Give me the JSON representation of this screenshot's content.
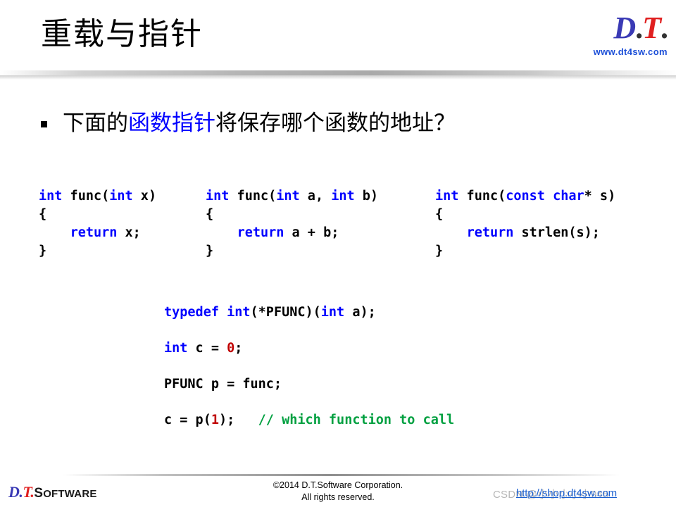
{
  "slide": {
    "title": "重载与指针",
    "bullet": {
      "prefix": "下面的",
      "highlight": "函数指针",
      "suffix": "将保存哪个函数的地址？"
    }
  },
  "logo": {
    "d": "D",
    "dot1": ".",
    "t": "T",
    "dot2": ".",
    "url": "www.dt4sw.com"
  },
  "code": {
    "col1": [
      {
        "segments": [
          {
            "t": "int",
            "c": "kw"
          },
          {
            "t": " func(",
            "c": ""
          },
          {
            "t": "int",
            "c": "kw"
          },
          {
            "t": " x)",
            "c": ""
          }
        ]
      },
      {
        "segments": [
          {
            "t": "{",
            "c": ""
          }
        ]
      },
      {
        "segments": [
          {
            "t": "    ",
            "c": ""
          },
          {
            "t": "return",
            "c": "kw"
          },
          {
            "t": " x;",
            "c": ""
          }
        ]
      },
      {
        "segments": [
          {
            "t": "}",
            "c": ""
          }
        ]
      }
    ],
    "col2": [
      {
        "segments": [
          {
            "t": "int",
            "c": "kw"
          },
          {
            "t": " func(",
            "c": ""
          },
          {
            "t": "int",
            "c": "kw"
          },
          {
            "t": " a, ",
            "c": ""
          },
          {
            "t": "int",
            "c": "kw"
          },
          {
            "t": " b)",
            "c": ""
          }
        ]
      },
      {
        "segments": [
          {
            "t": "{",
            "c": ""
          }
        ]
      },
      {
        "segments": [
          {
            "t": "    ",
            "c": ""
          },
          {
            "t": "return",
            "c": "kw"
          },
          {
            "t": " a + b;",
            "c": ""
          }
        ]
      },
      {
        "segments": [
          {
            "t": "}",
            "c": ""
          }
        ]
      }
    ],
    "col3": [
      {
        "segments": [
          {
            "t": "int",
            "c": "kw"
          },
          {
            "t": " func(",
            "c": ""
          },
          {
            "t": "const",
            "c": "kw"
          },
          {
            "t": " ",
            "c": ""
          },
          {
            "t": "char",
            "c": "kw"
          },
          {
            "t": "* s)",
            "c": ""
          }
        ]
      },
      {
        "segments": [
          {
            "t": "{",
            "c": ""
          }
        ]
      },
      {
        "segments": [
          {
            "t": "    ",
            "c": ""
          },
          {
            "t": "return",
            "c": "kw"
          },
          {
            "t": " strlen(s);",
            "c": ""
          }
        ]
      },
      {
        "segments": [
          {
            "t": "}",
            "c": ""
          }
        ]
      }
    ],
    "main": [
      {
        "segments": [
          {
            "t": "typedef",
            "c": "kw"
          },
          {
            "t": " ",
            "c": ""
          },
          {
            "t": "int",
            "c": "kw"
          },
          {
            "t": "(*PFUNC)(",
            "c": ""
          },
          {
            "t": "int",
            "c": "kw"
          },
          {
            "t": " a);",
            "c": ""
          }
        ]
      },
      {
        "segments": [
          {
            "t": "int",
            "c": "kw"
          },
          {
            "t": " c = ",
            "c": ""
          },
          {
            "t": "0",
            "c": "num"
          },
          {
            "t": ";",
            "c": ""
          }
        ]
      },
      {
        "segments": [
          {
            "t": "PFUNC p = func;",
            "c": ""
          }
        ]
      },
      {
        "segments": [
          {
            "t": "c = p(",
            "c": ""
          },
          {
            "t": "1",
            "c": "num"
          },
          {
            "t": ");   ",
            "c": ""
          },
          {
            "t": "// which function to call",
            "c": "cmt"
          }
        ]
      }
    ]
  },
  "footer": {
    "logo_d": "D",
    "logo_dot1": ".",
    "logo_t": "T",
    "logo_dot2": ".",
    "logo_word_cap": "S",
    "logo_word_rest": "OFTWARE",
    "copyright_line1": "©2014 D.T.Software Corporation.",
    "copyright_line2": "All rights reserved.",
    "csdn_watermark": "CSDN @小小小小小945",
    "shop_link": "http://shop.dt4sw.com"
  },
  "colors": {
    "header_gold": "#eec93f",
    "keyword_blue": "#0000ff",
    "number_red": "#c00000",
    "comment_green": "#00a040",
    "logo_blue": "#3a3ab5",
    "logo_red": "#e02020",
    "link_blue": "#1a5fd0"
  }
}
